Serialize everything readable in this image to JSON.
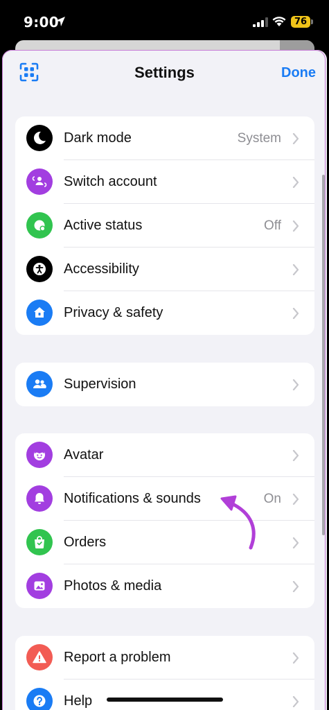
{
  "status": {
    "time": "9:00",
    "battery": "76"
  },
  "header": {
    "title": "Settings",
    "done_label": "Done"
  },
  "groups": [
    {
      "items": [
        {
          "label": "Dark mode",
          "value": "System",
          "icon": "moon-icon",
          "color": "#000000"
        },
        {
          "label": "Switch account",
          "value": "",
          "icon": "switch-account-icon",
          "color": "#a23ee0"
        },
        {
          "label": "Active status",
          "value": "Off",
          "icon": "active-status-icon",
          "color": "#31c44f"
        },
        {
          "label": "Accessibility",
          "value": "",
          "icon": "accessibility-icon",
          "color": "#000000"
        },
        {
          "label": "Privacy & safety",
          "value": "",
          "icon": "privacy-house-icon",
          "color": "#1a7cf4"
        }
      ]
    },
    {
      "items": [
        {
          "label": "Supervision",
          "value": "",
          "icon": "supervision-people-icon",
          "color": "#1a7cf4"
        }
      ]
    },
    {
      "items": [
        {
          "label": "Avatar",
          "value": "",
          "icon": "avatar-face-icon",
          "color": "#a23ee0"
        },
        {
          "label": "Notifications & sounds",
          "value": "On",
          "icon": "bell-icon",
          "color": "#a23ee0"
        },
        {
          "label": "Orders",
          "value": "",
          "icon": "shopping-bag-icon",
          "color": "#31c44f"
        },
        {
          "label": "Photos & media",
          "value": "",
          "icon": "photo-icon",
          "color": "#a23ee0"
        }
      ]
    },
    {
      "items": [
        {
          "label": "Report a problem",
          "value": "",
          "icon": "warning-icon",
          "color": "#f25c54"
        },
        {
          "label": "Help",
          "value": "",
          "icon": "help-icon",
          "color": "#1a7cf4"
        }
      ]
    }
  ],
  "colors": {
    "accent": "#1a7cf4",
    "annotation": "#b13fd8"
  }
}
